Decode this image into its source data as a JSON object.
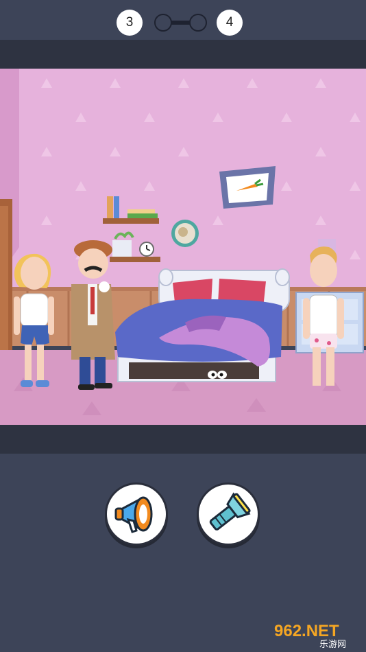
{
  "level": {
    "current": "3",
    "next": "4"
  },
  "tools": [
    {
      "name": "megaphone",
      "icon": "megaphone-icon"
    },
    {
      "name": "flashlight",
      "icon": "flashlight-icon"
    }
  ],
  "scene": {
    "description_icons": [
      "detective",
      "girl",
      "man-in-underwear",
      "bed",
      "hiding-eyes",
      "carrot-picture",
      "clock",
      "shelf"
    ]
  },
  "watermark": {
    "main": "962.NET",
    "sub": "乐游网"
  },
  "colors": {
    "background": "#3d4458",
    "band": "#2e3341",
    "wall": "#e6b2dc",
    "floor": "#d79ac4",
    "bed_blanket": "#5a69c8",
    "accent_orange": "#f28a1e"
  }
}
